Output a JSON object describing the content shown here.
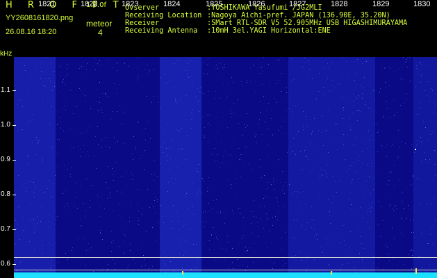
{
  "header": {
    "title": "H R O F F T",
    "version": "1.0.0f",
    "filename": "YY2608161820.png",
    "datetime": "26.08.16 18:20",
    "meteor_label": "meteor",
    "meteor_count": "4"
  },
  "station": [
    {
      "key": "Ovserver",
      "value": ":YOSHIKAWA Yasufumi /JG2MLI"
    },
    {
      "key": "Receiving Location",
      "value": ":Nagoya Aichi-pref. JAPAN (136.90E, 35.20N)"
    },
    {
      "key": "Receiver",
      "value": ":SMart RTL-SDR V5 52.905MHz USB HIGASHIMURAYAMA"
    },
    {
      "key": "Receiving Antenna",
      "value": ":10mH 3el.YAGI Horizontal:ENE"
    }
  ],
  "axis": {
    "y_unit": "kHz",
    "y_ticks": [
      "1.1",
      "1.0",
      "0.9",
      "0.8",
      "0.7",
      "0.6"
    ],
    "x_minutes": [
      "1821",
      "1822",
      "1823",
      "1824",
      "1825",
      "1826",
      "1827",
      "1828",
      "1829",
      "1830"
    ]
  },
  "colors": {
    "background": "#000000",
    "text_accent": "#d8ff3a",
    "plot_base": "#0a0a86",
    "baseline": "#1ce0ff",
    "meteor": "#ffe14a"
  }
}
